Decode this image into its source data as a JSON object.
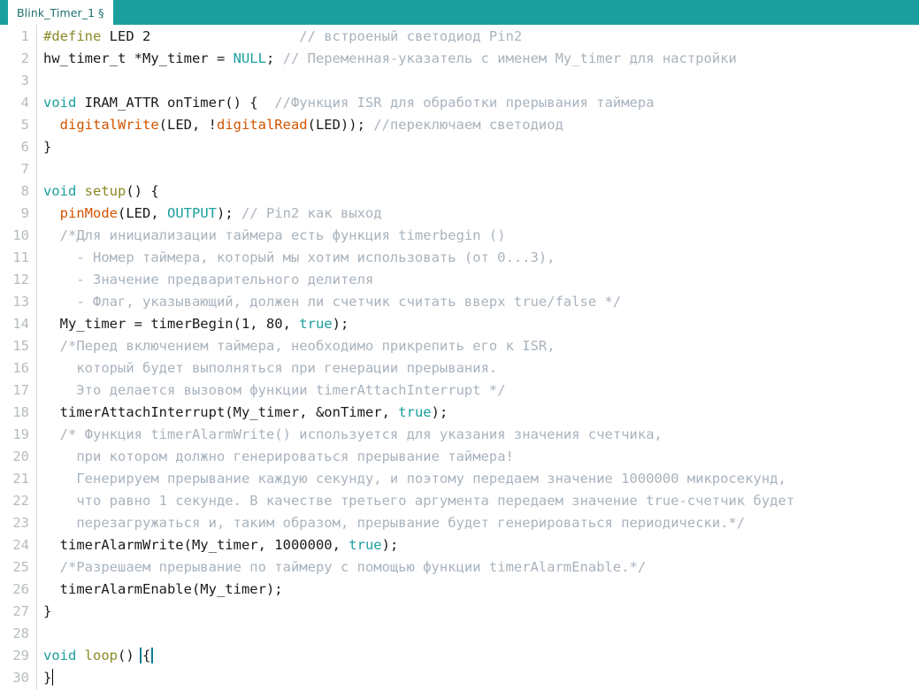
{
  "window": {
    "app": "arduino-ide-editor",
    "accent_color": "#1b9e9e",
    "background": "#ffffff"
  },
  "tab_bar": {
    "active_tab_label": "Blink_Timer_1 §",
    "tabs": [
      "Blink_Timer_1 §"
    ]
  },
  "colors": {
    "preprocessor": "#8a8a27",
    "keyword": "#1b9e9e",
    "function": "#d35400",
    "comment": "#a9b3bd",
    "text": "#1b1b1b",
    "line_number": "#b6bcbc",
    "brace_match_outline": "#0d7c95"
  },
  "editor": {
    "first_line": 1,
    "last_line": 30,
    "total_lines": 30,
    "cursor_line": 30,
    "brace_match_line": 29,
    "lines": [
      {
        "n": "1",
        "tokens": [
          {
            "t": "pre",
            "s": "#define"
          },
          {
            "t": "txt",
            "s": " LED 2                  "
          },
          {
            "t": "cmt",
            "s": "// встроеный светодиод Pin2"
          }
        ]
      },
      {
        "n": "2",
        "tokens": [
          {
            "t": "txt",
            "s": "hw_timer_t *My_timer = "
          },
          {
            "t": "kw",
            "s": "NULL"
          },
          {
            "t": "txt",
            "s": "; "
          },
          {
            "t": "cmt",
            "s": "// Переменная-указатель с именем My_timer для настройки"
          }
        ]
      },
      {
        "n": "3",
        "tokens": []
      },
      {
        "n": "4",
        "tokens": [
          {
            "t": "kw",
            "s": "void"
          },
          {
            "t": "txt",
            "s": " IRAM_ATTR onTimer() {  "
          },
          {
            "t": "cmt",
            "s": "//Функция ISR для обработки прерывания таймера"
          }
        ]
      },
      {
        "n": "5",
        "tokens": [
          {
            "t": "txt",
            "s": "  "
          },
          {
            "t": "fn",
            "s": "digitalWrite"
          },
          {
            "t": "txt",
            "s": "(LED, !"
          },
          {
            "t": "fn",
            "s": "digitalRead"
          },
          {
            "t": "txt",
            "s": "(LED)); "
          },
          {
            "t": "cmt",
            "s": "//переключаем светодиод"
          }
        ]
      },
      {
        "n": "6",
        "tokens": [
          {
            "t": "txt",
            "s": "}"
          }
        ]
      },
      {
        "n": "7",
        "tokens": []
      },
      {
        "n": "8",
        "tokens": [
          {
            "t": "kw",
            "s": "void"
          },
          {
            "t": "txt",
            "s": " "
          },
          {
            "t": "pre",
            "s": "setup"
          },
          {
            "t": "txt",
            "s": "() {"
          }
        ]
      },
      {
        "n": "9",
        "tokens": [
          {
            "t": "txt",
            "s": "  "
          },
          {
            "t": "fn",
            "s": "pinMode"
          },
          {
            "t": "txt",
            "s": "(LED, "
          },
          {
            "t": "kw",
            "s": "OUTPUT"
          },
          {
            "t": "txt",
            "s": "); "
          },
          {
            "t": "cmt",
            "s": "// Pin2 как выход"
          }
        ]
      },
      {
        "n": "10",
        "tokens": [
          {
            "t": "cmt",
            "s": "  /*Для инициализации таймера есть функция timerbegin ()"
          }
        ]
      },
      {
        "n": "11",
        "tokens": [
          {
            "t": "cmt",
            "s": "    - Номер таймера, который мы хотим использовать (от 0...3),"
          }
        ]
      },
      {
        "n": "12",
        "tokens": [
          {
            "t": "cmt",
            "s": "    - Значение предварительного делителя"
          }
        ]
      },
      {
        "n": "13",
        "tokens": [
          {
            "t": "cmt",
            "s": "    - Флаг, указывающий, должен ли счетчик считать вверх true/false */"
          }
        ]
      },
      {
        "n": "14",
        "tokens": [
          {
            "t": "txt",
            "s": "  My_timer = timerBegin(1, 80, "
          },
          {
            "t": "kw",
            "s": "true"
          },
          {
            "t": "txt",
            "s": ");"
          }
        ]
      },
      {
        "n": "15",
        "tokens": [
          {
            "t": "cmt",
            "s": "  /*Перед включением таймера, необходимо прикрепить его к ISR,"
          }
        ]
      },
      {
        "n": "16",
        "tokens": [
          {
            "t": "cmt",
            "s": "    который будет выполняться при генерации прерывания."
          }
        ]
      },
      {
        "n": "17",
        "tokens": [
          {
            "t": "cmt",
            "s": "    Это делается вызовом функции timerAttachInterrupt */"
          }
        ]
      },
      {
        "n": "18",
        "tokens": [
          {
            "t": "txt",
            "s": "  timerAttachInterrupt(My_timer, &onTimer, "
          },
          {
            "t": "kw",
            "s": "true"
          },
          {
            "t": "txt",
            "s": ");"
          }
        ]
      },
      {
        "n": "19",
        "tokens": [
          {
            "t": "cmt",
            "s": "  /* Функция timerAlarmWrite() используется для указания значения счетчика,"
          }
        ]
      },
      {
        "n": "20",
        "tokens": [
          {
            "t": "cmt",
            "s": "    при котором должно генерироваться прерывание таймера!"
          }
        ]
      },
      {
        "n": "21",
        "tokens": [
          {
            "t": "cmt",
            "s": "    Генерируем прерывание каждую секунду, и поэтому передаем значение 1000000 микросекунд,"
          }
        ]
      },
      {
        "n": "22",
        "tokens": [
          {
            "t": "cmt",
            "s": "    что равно 1 секунде. В качестве третьего аргумента передаем значение true-счетчик будет"
          }
        ]
      },
      {
        "n": "23",
        "tokens": [
          {
            "t": "cmt",
            "s": "    перезагружаться и, таким образом, прерывание будет генерироваться периодически.*/"
          }
        ]
      },
      {
        "n": "24",
        "tokens": [
          {
            "t": "txt",
            "s": "  timerAlarmWrite(My_timer, 1000000, "
          },
          {
            "t": "kw",
            "s": "true"
          },
          {
            "t": "txt",
            "s": ");"
          }
        ]
      },
      {
        "n": "25",
        "tokens": [
          {
            "t": "cmt",
            "s": "  /*Разрешаем прерывание по таймеру с помощью функции timerAlarmEnable.*/"
          }
        ]
      },
      {
        "n": "26",
        "tokens": [
          {
            "t": "txt",
            "s": "  timerAlarmEnable(My_timer);"
          }
        ]
      },
      {
        "n": "27",
        "tokens": [
          {
            "t": "txt",
            "s": "}"
          }
        ]
      },
      {
        "n": "28",
        "tokens": []
      },
      {
        "n": "29",
        "tokens": [
          {
            "t": "kw",
            "s": "void"
          },
          {
            "t": "txt",
            "s": " "
          },
          {
            "t": "pre",
            "s": "loop"
          },
          {
            "t": "txt",
            "s": "() "
          },
          {
            "t": "brace",
            "s": "{"
          }
        ]
      },
      {
        "n": "30",
        "tokens": [
          {
            "t": "txt",
            "s": "}"
          },
          {
            "t": "caret",
            "s": ""
          }
        ]
      }
    ]
  }
}
